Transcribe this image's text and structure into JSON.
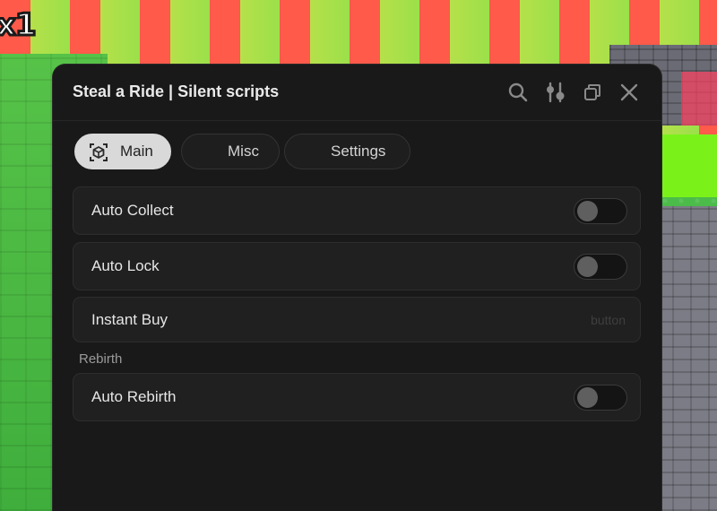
{
  "background": {
    "multiplier": "x1"
  },
  "window": {
    "title": "Steal a Ride | Silent scripts",
    "controls": [
      "search-icon",
      "sliders-icon",
      "minimize-icon",
      "close-icon"
    ]
  },
  "tabs": [
    {
      "label": "Main",
      "icon": "cube-icon",
      "active": true
    },
    {
      "label": "Misc",
      "active": false
    },
    {
      "label": "Settings",
      "active": false
    }
  ],
  "rows": [
    {
      "label": "Auto Collect",
      "type": "toggle",
      "on": false
    },
    {
      "label": "Auto Lock",
      "type": "toggle",
      "on": false
    },
    {
      "label": "Instant Buy",
      "type": "button",
      "hint": "button"
    }
  ],
  "section": {
    "title": "Rebirth",
    "rows": [
      {
        "label": "Auto Rebirth",
        "type": "toggle",
        "on": false
      }
    ]
  },
  "colors": {
    "window_bg": "#191919",
    "row_bg": "#202020",
    "active_tab": "#d9d9d9"
  }
}
